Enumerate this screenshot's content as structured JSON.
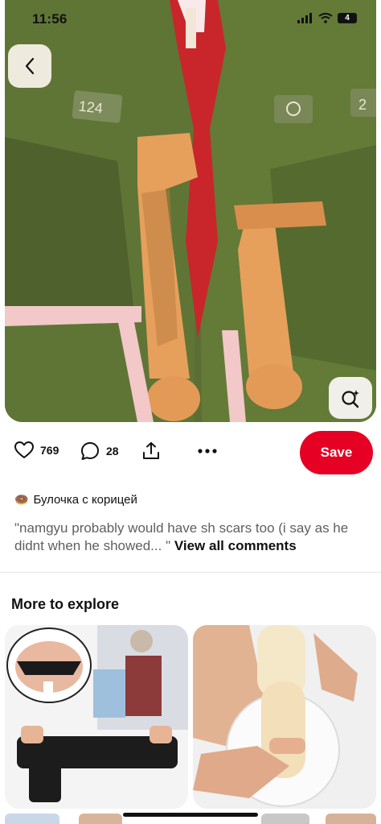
{
  "status": {
    "time": "11:56",
    "battery": "4"
  },
  "hero": {
    "badge_left": "124",
    "badge_right": "2"
  },
  "actions": {
    "likes": "769",
    "comments": "28",
    "save_label": "Save"
  },
  "comment": {
    "author_emoji": "🍩",
    "author": "Булочка с корицей",
    "text": "\"namgyu probably would have sh scars too (i say as he didnt when he showed... \"",
    "view_all": "View all comments"
  },
  "explore": {
    "title": "More to explore"
  },
  "colors": {
    "save": "#e60023",
    "hero_jacket": "#5b6d33",
    "hero_red": "#d6262a"
  },
  "icons": [
    "chevron-left-icon",
    "visual-search-icon",
    "heart-icon",
    "comment-icon",
    "share-icon",
    "more-icon"
  ]
}
